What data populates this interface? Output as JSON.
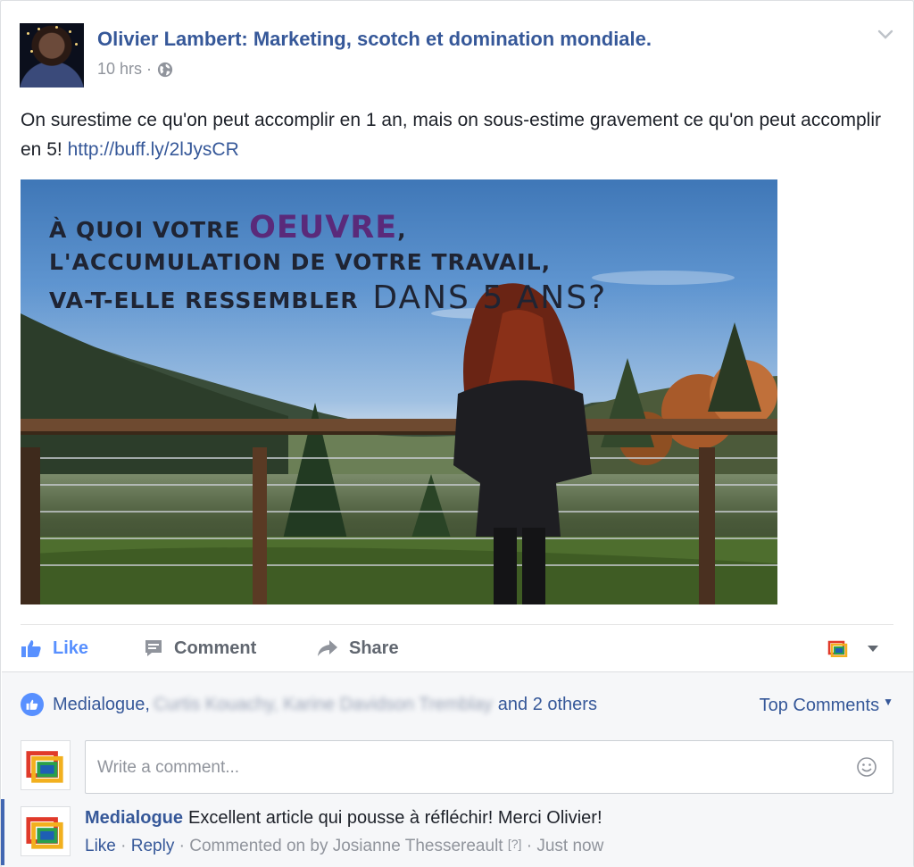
{
  "post": {
    "page_name": "Olivier Lambert: Marketing, scotch et domination mondiale.",
    "time": "10 hrs",
    "separator": "·",
    "text": "On surestime ce qu'on peut accomplir en 1 an, mais on sous-estime gravement ce qu'on peut accomplir en 5!",
    "link": "http://buff.ly/2lJysCR",
    "privacy_icon": "globe-icon",
    "menu_icon": "chevron-down-icon"
  },
  "image": {
    "line1_prefix": "À QUOI VOTRE",
    "line1_accent": "OEUVRE",
    "line1_suffix": ",",
    "line2": "L'ACCUMULATION DE VOTRE TRAVAIL,",
    "line3_bold": "VA-T-ELLE RESSEMBLER",
    "line3_light": "DANS 5 ANS?",
    "accent_color": "#5a2a7a"
  },
  "actions": {
    "like": "Like",
    "comment": "Comment",
    "share": "Share"
  },
  "reactions": {
    "first": "Medialogue,",
    "blurred": "Curtis Kouachy, Karine Davidson Tremblay",
    "others": "and 2 others",
    "sort_label": "Top Comments"
  },
  "composer": {
    "placeholder": "Write a comment..."
  },
  "comment": {
    "author": "Medialogue",
    "text": "Excellent article qui pousse à réfléchir! Merci Olivier!",
    "like": "Like",
    "reply": "Reply",
    "commented_on": "Commented on by Josianne Thessereault",
    "help": "[?]",
    "time": "Just now"
  },
  "colors": {
    "link": "#365899",
    "like_blue": "#5890ff",
    "muted": "#90949c"
  }
}
